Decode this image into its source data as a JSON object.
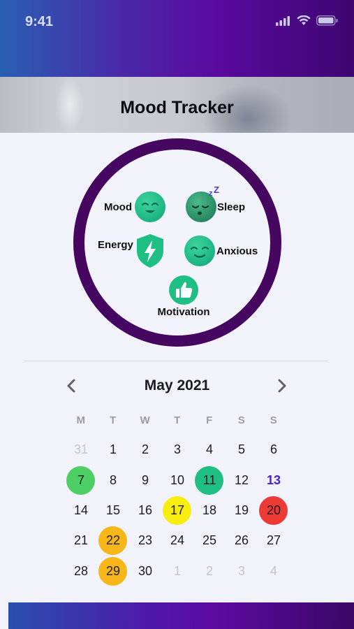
{
  "status_bar": {
    "time": "9:41"
  },
  "header": {
    "title": "Mood Tracker"
  },
  "wheel": {
    "items": [
      {
        "label": "Mood",
        "icon": "smile-face-icon"
      },
      {
        "label": "Sleep",
        "icon": "sleeping-face-icon"
      },
      {
        "label": "Energy",
        "icon": "energy-shield-icon"
      },
      {
        "label": "Anxious",
        "icon": "calm-face-icon"
      },
      {
        "label": "Motivation",
        "icon": "thumbs-up-icon"
      }
    ],
    "sleep_z": "z",
    "sleep_z2": "Z"
  },
  "calendar": {
    "month_title": "May 2021",
    "weekdays": [
      "M",
      "T",
      "W",
      "T",
      "F",
      "S",
      "S"
    ],
    "rows": [
      [
        "31",
        "1",
        "2",
        "3",
        "4",
        "5",
        "6"
      ],
      [
        "7",
        "8",
        "9",
        "10",
        "11",
        "12",
        "13"
      ],
      [
        "14",
        "15",
        "16",
        "17",
        "18",
        "19",
        "20"
      ],
      [
        "21",
        "22",
        "23",
        "24",
        "25",
        "26",
        "27"
      ],
      [
        "28",
        "29",
        "30",
        "1",
        "2",
        "3",
        "4"
      ]
    ],
    "today": "13",
    "mood_colors": {
      "great": "#4ecf66",
      "good": "#1fbf84",
      "okay": "#f7ee10",
      "meh": "#f7b719",
      "bad": "#ec3a36"
    },
    "marked_days": {
      "7": "great",
      "11": "good",
      "17": "okay",
      "20": "bad",
      "22": "meh",
      "29": "meh"
    }
  },
  "colors": {
    "accent": "#45075f",
    "today": "#4b1fd1"
  }
}
